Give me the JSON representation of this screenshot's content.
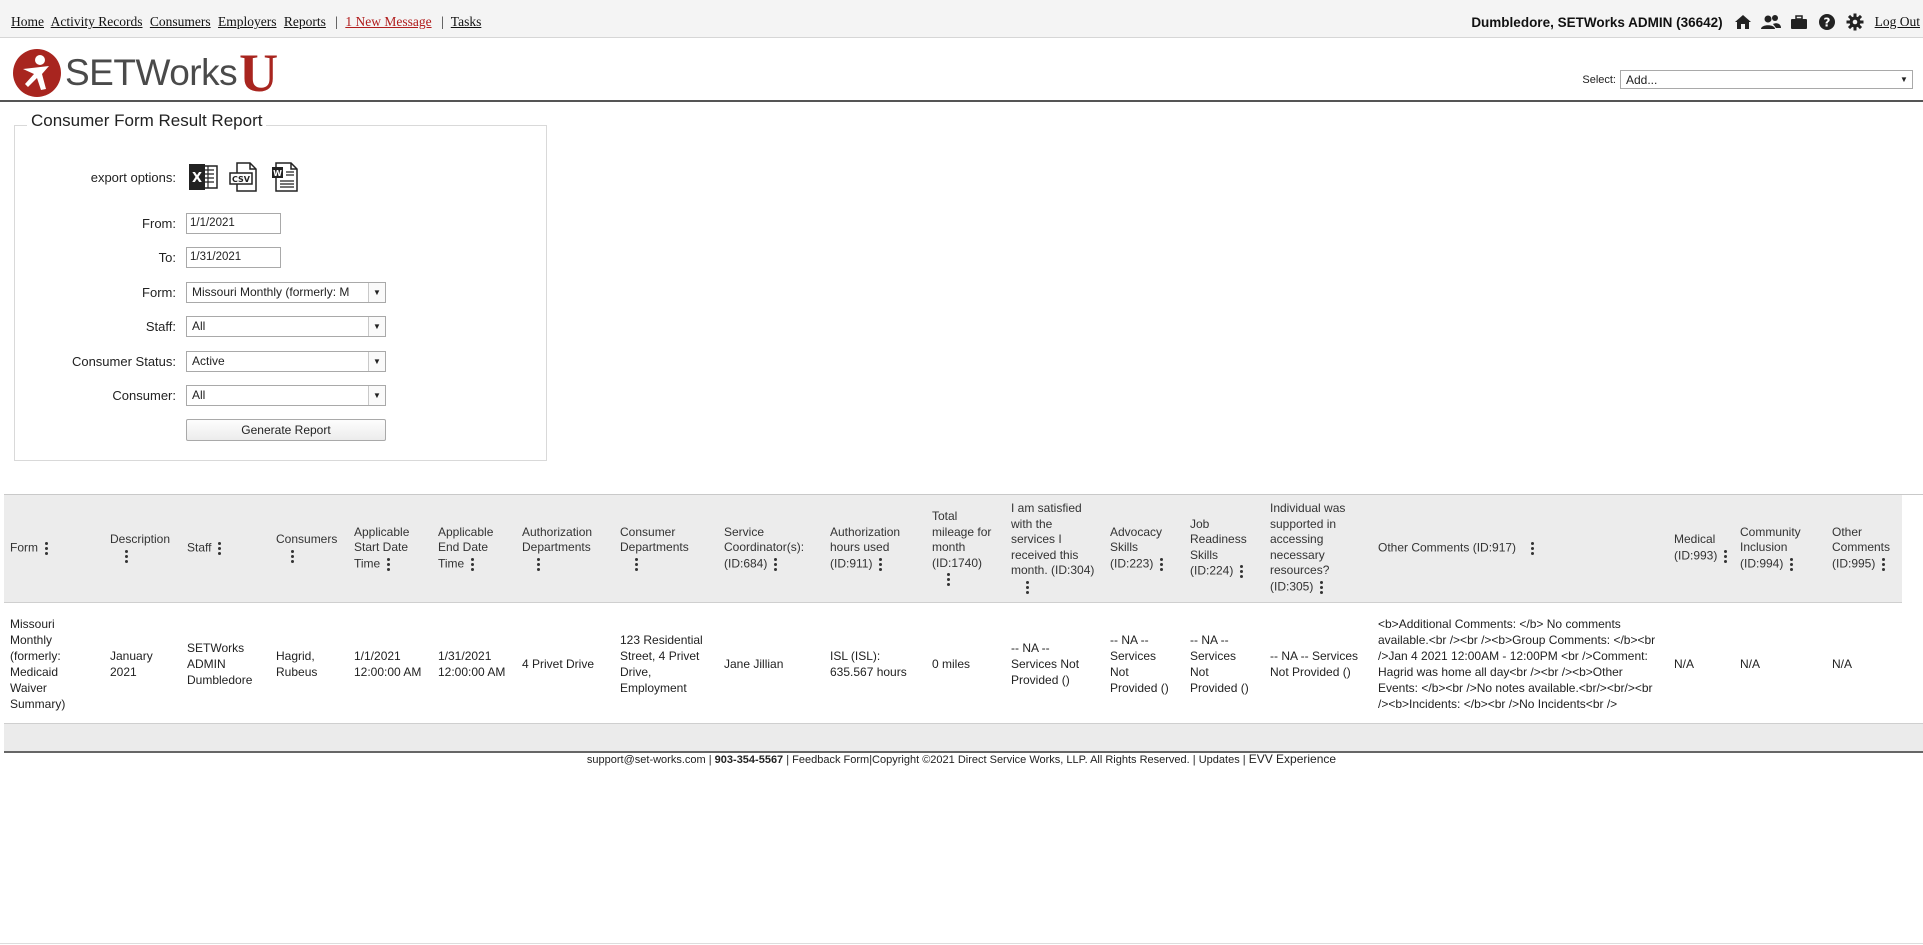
{
  "nav": {
    "home": "Home",
    "activity_records": "Activity Records",
    "consumers": "Consumers",
    "employers": "Employers",
    "reports": "Reports",
    "sep1": "|",
    "new_message": "1 New Message",
    "sep2": "|",
    "tasks": "Tasks",
    "user": "Dumbledore, SETWorks ADMIN (36642)",
    "logout": "Log Out",
    "icons": [
      "home-icon",
      "users-icon",
      "briefcase-icon",
      "help-icon",
      "gear-icon"
    ]
  },
  "header": {
    "logo_text": "SETWorks",
    "logo_u": "U",
    "select_label": "Select:",
    "select_value": "Add..."
  },
  "report": {
    "title": "Consumer Form Result Report",
    "export_label": "export options:",
    "export_icons": [
      "excel-icon",
      "csv-icon",
      "word-icon"
    ],
    "from_label": "From:",
    "from_value": "1/1/2021",
    "to_label": "To:",
    "to_value": "1/31/2021",
    "form_label": "Form:",
    "form_value": "Missouri Monthly (formerly: M",
    "staff_label": "Staff:",
    "staff_value": "All",
    "status_label": "Consumer Status:",
    "status_value": "Active",
    "consumer_label": "Consumer:",
    "consumer_value": "All",
    "generate_label": "Generate Report"
  },
  "table": {
    "headers": [
      "Form",
      "Description",
      "Staff",
      "Consumers",
      "Applicable Start Date Time",
      "Applicable End Date Time",
      "Authorization Departments",
      "Consumer Departments",
      "Service Coordinator(s): (ID:684)",
      "Authorization hours used (ID:911)",
      "Total mileage for month (ID:1740)",
      "I am satisfied with the services I received this month. (ID:304)",
      "Advocacy Skills (ID:223)",
      "Job Readiness Skills (ID:224)",
      "Individual was supported in accessing necessary resources? (ID:305)",
      "Other Comments (ID:917)",
      "Medical (ID:993)",
      "Community Inclusion (ID:994)",
      "Other Comments (ID:995)"
    ],
    "rows": [
      [
        "Missouri Monthly (formerly: Medicaid Waiver Summary)",
        "January 2021",
        "SETWorks ADMIN Dumbledore",
        "Hagrid, Rubeus",
        "1/1/2021 12:00:00 AM",
        "1/31/2021 12:00:00 AM",
        "4 Privet Drive",
        "123 Residential Street, 4 Privet Drive, Employment",
        "Jane Jillian",
        "ISL (ISL): 635.567 hours",
        "0 miles",
        "-- NA -- Services Not Provided ()",
        "-- NA -- Services Not Provided ()",
        "-- NA -- Services Not Provided ()",
        "-- NA -- Services Not Provided ()",
        "<b>Additional Comments: </b> No comments available.<br /><br /><b>Group Comments: </b><br />Jan 4 2021 12:00AM - 12:00PM <br />Comment: Hagrid was home all day<br /><br /><b>Other Events: </b><br />No notes available.<br/><br/><br /><b>Incidents: </b><br />No Incidents<br />",
        "N/A",
        "N/A",
        "N/A"
      ]
    ]
  },
  "footer": {
    "email": "support@set-works.com",
    "sep1": "|",
    "phone": "903-354-5567",
    "sep2": "|",
    "feedback": "Feedback Form",
    "copyright": "|Copyright ©2021 Direct Service Works, LLP. All Rights Reserved.",
    "sep3": "|",
    "updates": "Updates",
    "sep4": "|",
    "evv": "EVV Experience"
  },
  "colors": {
    "brand_red": "#a8251f",
    "link_red": "#b01c1c"
  }
}
